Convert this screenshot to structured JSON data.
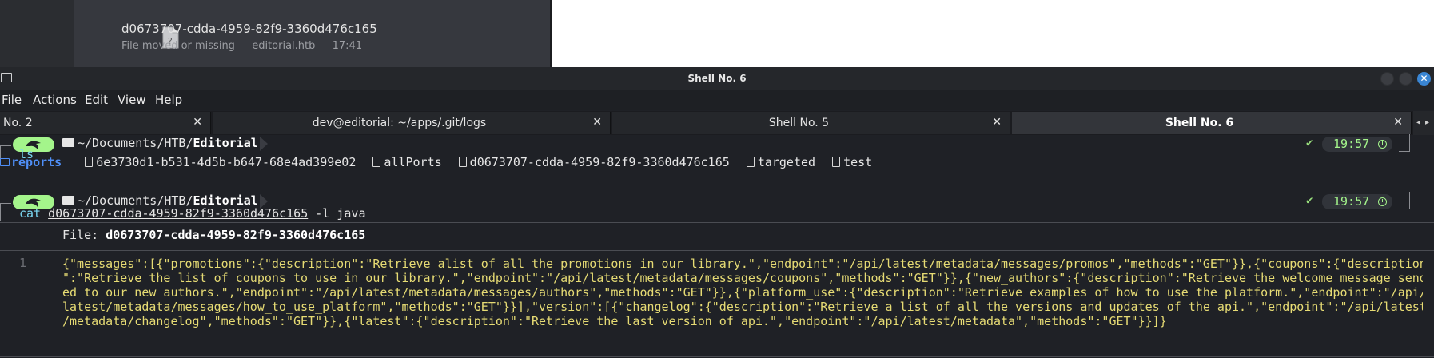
{
  "file_manager": {
    "file_name": "d0673707-cdda-4959-82f9-3360d476c165",
    "file_status": "File moved or missing — editorial.htb — 17:41"
  },
  "window": {
    "title": "Shell No. 6",
    "close_glyph": "✕"
  },
  "menu": {
    "items": [
      "File",
      "Actions",
      "Edit",
      "View",
      "Help"
    ]
  },
  "tabs": [
    {
      "label": "No. 2",
      "active": false
    },
    {
      "label": "dev@editorial: ~/apps/.git/logs",
      "active": false
    },
    {
      "label": "Shell No. 5",
      "active": false
    },
    {
      "label": "Shell No. 6",
      "active": true
    }
  ],
  "tab_close_glyph": "✕",
  "tab_scroll": {
    "left": "◂",
    "right": "▸"
  },
  "prompts": [
    {
      "path_prefix": "~/Documents/HTB/",
      "path_bold": "Editorial",
      "time": "19:57",
      "check": "✔",
      "command": "ls"
    },
    {
      "path_prefix": "~/Documents/HTB/",
      "path_bold": "Editorial",
      "time": "19:57",
      "check": "✔",
      "command": "cat",
      "command_arg_file": "d0673707-cdda-4959-82f9-3360d476c165",
      "command_arg_rest": " -l java"
    }
  ],
  "ls_output": {
    "directory": "reports",
    "files": [
      "6e3730d1-b531-4d5b-b647-68e4ad399e02",
      "allPorts",
      "d0673707-cdda-4959-82f9-3360d476c165",
      "targeted",
      "test"
    ]
  },
  "bat": {
    "file_label": "File: ",
    "file_name": "d0673707-cdda-4959-82f9-3360d476c165",
    "line_number": "1",
    "lines": [
      "{\"messages\":[{\"promotions\":{\"description\":\"Retrieve alist of all the promotions in our library.\",\"endpoint\":\"/api/latest/metadata/messages/promos\",\"methods\":\"GET\"}},{\"coupons\":{\"description",
      "\":\"Retrieve the list of coupons to use in our library.\",\"endpoint\":\"/api/latest/metadata/messages/coupons\",\"methods\":\"GET\"}},{\"new_authors\":{\"description\":\"Retrieve the welcome message send",
      "ed to our new authors.\",\"endpoint\":\"/api/latest/metadata/messages/authors\",\"methods\":\"GET\"}},{\"platform_use\":{\"description\":\"Retrieve examples of how to use the platform.\",\"endpoint\":\"/api/",
      "latest/metadata/messages/how_to_use_platform\",\"methods\":\"GET\"}}],\"version\":[{\"changelog\":{\"description\":\"Retrieve a list of all the versions and updates of the api.\",\"endpoint\":\"/api/latest",
      "/metadata/changelog\",\"methods\":\"GET\"}},{\"latest\":{\"description\":\"Retrieve the last version of api.\",\"endpoint\":\"/api/latest/metadata\",\"methods\":\"GET\"}}]}"
    ]
  },
  "colors": {
    "prompt_green": "#a4f58b",
    "command_cyan": "#7ad6f0",
    "directory_blue": "#4f8ff7",
    "string_yellow": "#e6db74",
    "key_pink": "#f6a8c8",
    "close_blue": "#3a86d4"
  },
  "icons": {
    "os_badge": "kali-dragon-icon",
    "folder": "folder-open-icon",
    "file": "file-icon",
    "clock": "clock-icon"
  }
}
